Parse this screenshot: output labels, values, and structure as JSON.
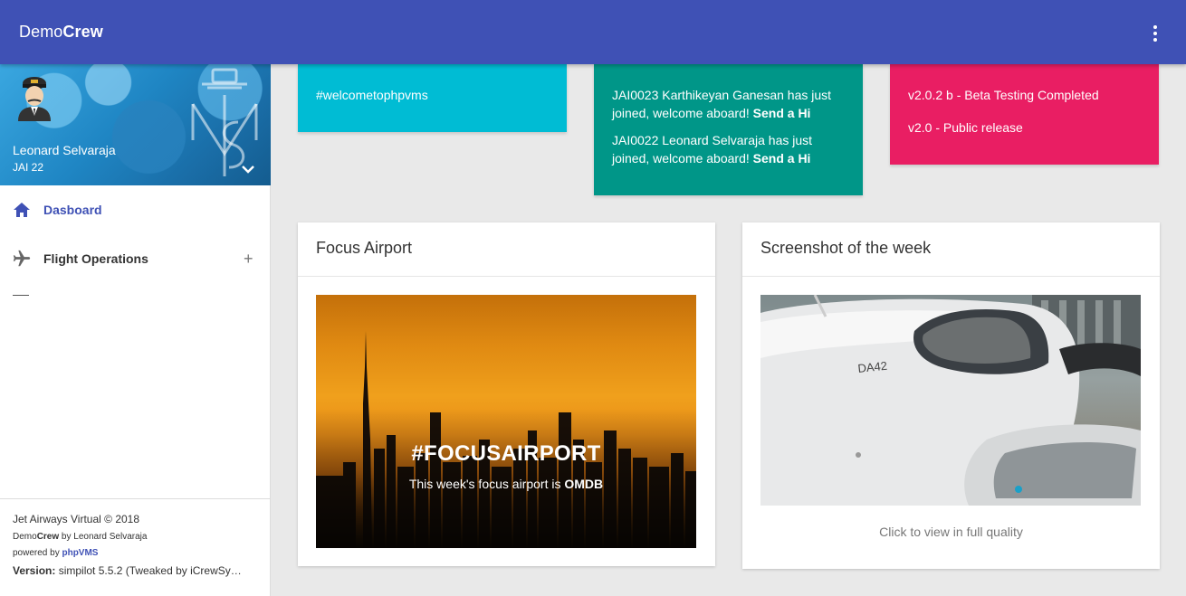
{
  "app": {
    "brand_prefix": "Demo",
    "brand_suffix": "Crew"
  },
  "user": {
    "name": "Leonard Selvaraja",
    "id": "JAI 22"
  },
  "nav": {
    "items": [
      {
        "label": "Dasboard",
        "icon": "home-icon",
        "active": true
      },
      {
        "label": "Flight Operations",
        "icon": "airplane-icon",
        "expand": "+"
      }
    ]
  },
  "footer": {
    "copyright": "Jet Airways Virtual © 2018",
    "credit_prefix": "Demo",
    "credit_brand": "Crew",
    "credit_by": " by Leonard Selvaraja",
    "powered_prefix": "powered by ",
    "powered_link": "phpVMS",
    "version_label": "Version:",
    "version_value": " simpilot 5.5.2 (Tweaked by iCrewSy…"
  },
  "cards_top": {
    "hashtag": "#welcometophpvms",
    "joins": [
      {
        "text": "JAI0023 Karthikeyan Ganesan has just joined, welcome aboard! ",
        "action": "Send a Hi"
      },
      {
        "text": "JAI0022 Leonard Selvaraja has just joined, welcome aboard! ",
        "action": "Send a Hi"
      }
    ],
    "releases": [
      "v2.0.2 b - Beta Testing Completed",
      "v2.0 - Public release"
    ]
  },
  "focus": {
    "header": "Focus Airport",
    "title": "#FOCUSAIRPORT",
    "subtitle_prefix": "This week's focus airport is ",
    "airport": "OMDB"
  },
  "screenshot": {
    "header": "Screenshot of the week",
    "plane_label": "DA42",
    "caption": "Click to view in full quality"
  },
  "colors": {
    "primary": "#3f51b5",
    "cyan": "#00bcd4",
    "teal": "#009688",
    "pink": "#e91e63"
  }
}
